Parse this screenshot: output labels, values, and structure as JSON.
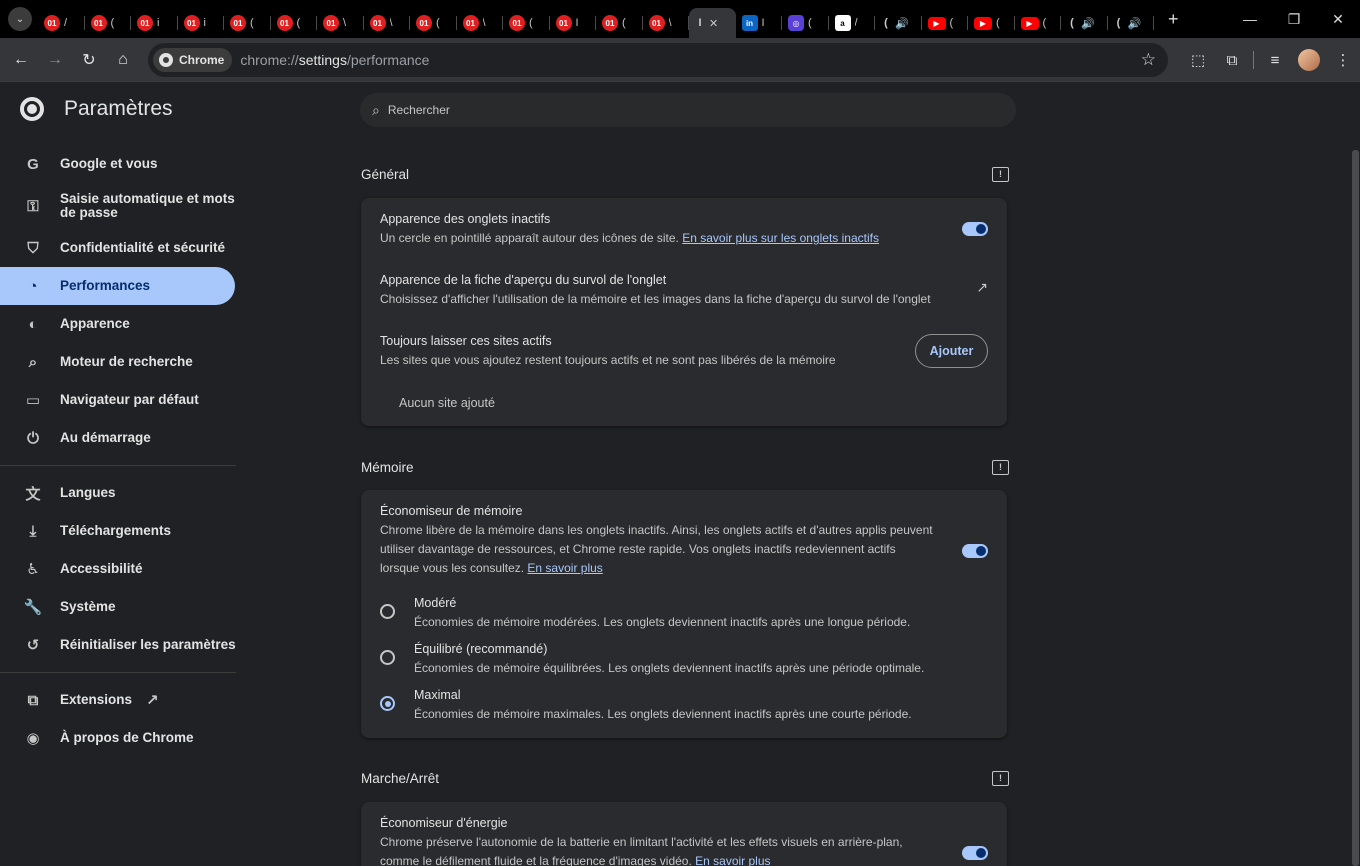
{
  "tabs": [
    {
      "fav": "01",
      "kind": "o1",
      "letter": "/"
    },
    {
      "fav": "01",
      "kind": "o1",
      "letter": "("
    },
    {
      "fav": "01",
      "kind": "o1",
      "letter": "i"
    },
    {
      "fav": "01",
      "kind": "o1",
      "letter": "i"
    },
    {
      "fav": "01",
      "kind": "o1",
      "letter": "("
    },
    {
      "fav": "01",
      "kind": "o1",
      "letter": "("
    },
    {
      "fav": "01",
      "kind": "o1",
      "letter": "\\"
    },
    {
      "fav": "01",
      "kind": "o1",
      "letter": "\\"
    },
    {
      "fav": "01",
      "kind": "o1",
      "letter": "("
    },
    {
      "fav": "01",
      "kind": "o1",
      "letter": "\\"
    },
    {
      "fav": "01",
      "kind": "o1",
      "letter": "("
    },
    {
      "fav": "01",
      "kind": "o1",
      "letter": "I"
    },
    {
      "fav": "01",
      "kind": "o1",
      "letter": "("
    },
    {
      "fav": "01",
      "kind": "o1",
      "letter": "\\"
    },
    {
      "fav": "I",
      "kind": "plain",
      "letter": "✕",
      "active": true
    },
    {
      "fav": "in",
      "kind": "li",
      "letter": "I"
    },
    {
      "fav": "◎",
      "kind": "sp",
      "letter": "("
    },
    {
      "fav": "a",
      "kind": "az",
      "letter": "/"
    },
    {
      "fav": "(",
      "kind": "plain",
      "letter": "🔊"
    },
    {
      "fav": "▶",
      "kind": "yt",
      "letter": "("
    },
    {
      "fav": "▶",
      "kind": "yt",
      "letter": "("
    },
    {
      "fav": "▶",
      "kind": "yt",
      "letter": "("
    },
    {
      "fav": "(",
      "kind": "plain",
      "letter": "🔊"
    },
    {
      "fav": "(",
      "kind": "plain",
      "letter": "🔊"
    }
  ],
  "toolbar": {
    "chip_label": "Chrome",
    "url_prefix": "chrome://",
    "url_host": "settings",
    "url_path": "/performance"
  },
  "sidebar": {
    "title": "Paramètres",
    "items": [
      {
        "label": "Google et vous",
        "icon": "G"
      },
      {
        "label": "Saisie automatique et mots de passe",
        "icon": "⚿"
      },
      {
        "label": "Confidentialité et sécurité",
        "icon": "⛉"
      },
      {
        "label": "Performances",
        "icon": "◔"
      },
      {
        "label": "Apparence",
        "icon": "◐"
      },
      {
        "label": "Moteur de recherche",
        "icon": "⌕"
      },
      {
        "label": "Navigateur par défaut",
        "icon": "▭"
      },
      {
        "label": "Au démarrage",
        "icon": "⏻"
      },
      {
        "label": "Langues",
        "icon": "文"
      },
      {
        "label": "Téléchargements",
        "icon": "⤓"
      },
      {
        "label": "Accessibilité",
        "icon": "♿"
      },
      {
        "label": "Système",
        "icon": "🔧"
      },
      {
        "label": "Réinitialiser les paramètres",
        "icon": "↺"
      },
      {
        "label": "Extensions",
        "icon": "⧉"
      },
      {
        "label": "À propos de Chrome",
        "icon": "◉"
      }
    ]
  },
  "search": {
    "placeholder": "Rechercher"
  },
  "sections": {
    "general": {
      "title": "Général",
      "inactive_tabs_title": "Apparence des onglets inactifs",
      "inactive_tabs_sub": "Un cercle en pointillé apparaît autour des icônes de site.",
      "inactive_tabs_link": "En savoir plus sur les onglets inactifs",
      "hover_card_title": "Apparence de la fiche d'aperçu du survol de l'onglet",
      "hover_card_sub": "Choisissez d'afficher l'utilisation de la mémoire et les images dans la fiche d'aperçu du survol de l'onglet",
      "always_active_title": "Toujours laisser ces sites actifs",
      "always_active_sub": "Les sites que vous ajoutez restent toujours actifs et ne sont pas libérés de la mémoire",
      "add_button": "Ajouter",
      "no_sites": "Aucun site ajouté"
    },
    "memory": {
      "title": "Mémoire",
      "saver_title": "Économiseur de mémoire",
      "saver_sub_1": "Chrome libère de la mémoire dans les onglets inactifs. Ainsi, les onglets actifs et d'autres applis peuvent",
      "saver_sub_2": "utiliser davantage de ressources, et Chrome reste rapide. Vos onglets inactifs redeviennent actifs",
      "saver_sub_3": "lorsque vous les consultez.",
      "saver_link": "En savoir plus",
      "options": [
        {
          "title": "Modéré",
          "sub": "Économies de mémoire modérées. Les onglets deviennent inactifs après une longue période."
        },
        {
          "title": "Équilibré (recommandé)",
          "sub": "Économies de mémoire équilibrées. Les onglets deviennent inactifs après une période optimale."
        },
        {
          "title": "Maximal",
          "sub": "Économies de mémoire maximales. Les onglets deviennent inactifs après une courte période."
        }
      ],
      "selected": "Maximal"
    },
    "power": {
      "title": "Marche/Arrêt",
      "saver_title": "Économiseur d'énergie",
      "saver_sub_1": "Chrome préserve l'autonomie de la batterie en limitant l'activité et les effets visuels en arrière-plan,",
      "saver_sub_2": "comme le défilement fluide et la fréquence d'images vidéo.",
      "saver_link": "En savoir plus"
    }
  },
  "colors": {
    "accent": "#a8c7fa",
    "background": "#202124",
    "card": "#2a2b2e"
  }
}
